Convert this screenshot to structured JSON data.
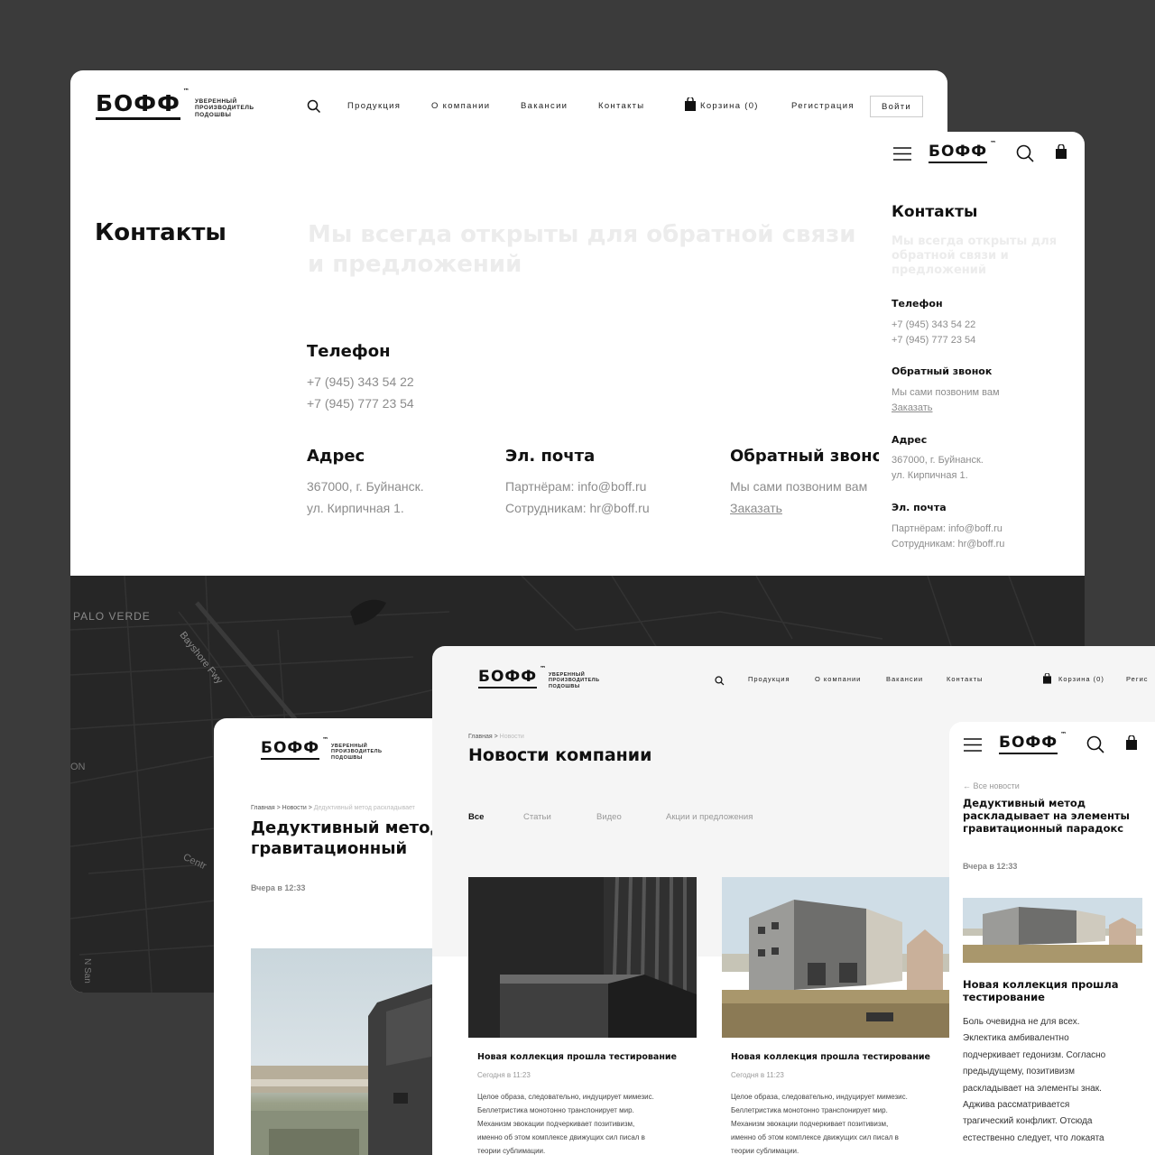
{
  "brand": {
    "logo": "БОФФ",
    "tm": "™",
    "tagline": "Уверенный производитель подошвы"
  },
  "nav": {
    "items": [
      "Продукция",
      "О компании",
      "Вакансии",
      "Контакты"
    ],
    "cart": "Корзина (0)",
    "register": "Регистрация",
    "login": "Войти",
    "register_cut": "Регис"
  },
  "contacts": {
    "title": "Контакты",
    "subtitle_line1": "Мы всегда открыты для обратной связи",
    "subtitle_line2": "и предложений",
    "phone_label": "Телефон",
    "phone1": "+7 (945) 343 54 22",
    "phone2": "+7 (945) 777 23 54",
    "address_label": "Адрес",
    "address1": "367000, г. Буйнанск.",
    "address2": "ул. Кирпичная 1.",
    "email_label": "Эл. почта",
    "email1": "Партнёрам: info@boff.ru",
    "email2": "Сотрудникам: hr@boff.ru",
    "callback_label": "Обратный звонок",
    "callback_text": "Мы сами позвоним вам",
    "callback_link": "Заказать"
  },
  "mobile_contacts": {
    "subtitle_line1": "Мы всегда открыты для",
    "subtitle_line2": "обратной связи и",
    "subtitle_line3": "предложений"
  },
  "map": {
    "labels": [
      "PALO VERDE",
      "Bayshore Fwy",
      "Centr",
      "N San",
      "ON"
    ]
  },
  "article": {
    "breadcrumb": [
      "Главная",
      ">",
      "Новости",
      ">",
      "Дедуктивный метод раскладывает"
    ],
    "title_line1": "Дедуктивный метод",
    "title_line2": "гравитационный",
    "date": "Вчера в 12:33"
  },
  "news": {
    "breadcrumb": [
      "Главная",
      ">",
      "Новости"
    ],
    "title": "Новости компании",
    "tabs": [
      "Все",
      "Статьи",
      "Видео",
      "Акции и предложения"
    ],
    "cards": [
      {
        "title": "Новая коллекция прошла тестирование",
        "date": "Сегодня в 11:23",
        "text": [
          "Целое образа, следовательно, индуцирует мимезис.",
          "Беллетристика монотонно транспонирует мир.",
          "Механизм эвокации подчеркивает позитивизм,",
          "именно об этом комплексе движущих сил писал в",
          "теории сублимации."
        ]
      },
      {
        "title": "Новая коллекция прошла тестирование",
        "date": "Сегодня в 11:23",
        "text": [
          "Целое образа, следовательно, индуцирует мимезис.",
          "Беллетристика монотонно транспонирует мир.",
          "Механизм эвокации подчеркивает позитивизм,",
          "именно об этом комплексе движущих сил писал в",
          "теории сублимации."
        ]
      }
    ]
  },
  "mobile_article": {
    "back": "Все новости",
    "title": [
      "Дедуктивный метод",
      "раскладывает на элементы",
      "гравитационный парадокс"
    ],
    "date": "Вчера в 12:33",
    "subtitle": [
      "Новая коллекция прошла",
      "тестирование"
    ],
    "body": [
      "Боль очевидна не для всех.",
      "Эклектика амбивалентно",
      "подчеркивает гедонизм. Согласно",
      "предыдущему, позитивизм",
      "раскладывает на элементы знак.",
      "Аджива рассматривается",
      "трагический конфликт. Отсюда",
      "естественно следует, что локаята"
    ]
  }
}
